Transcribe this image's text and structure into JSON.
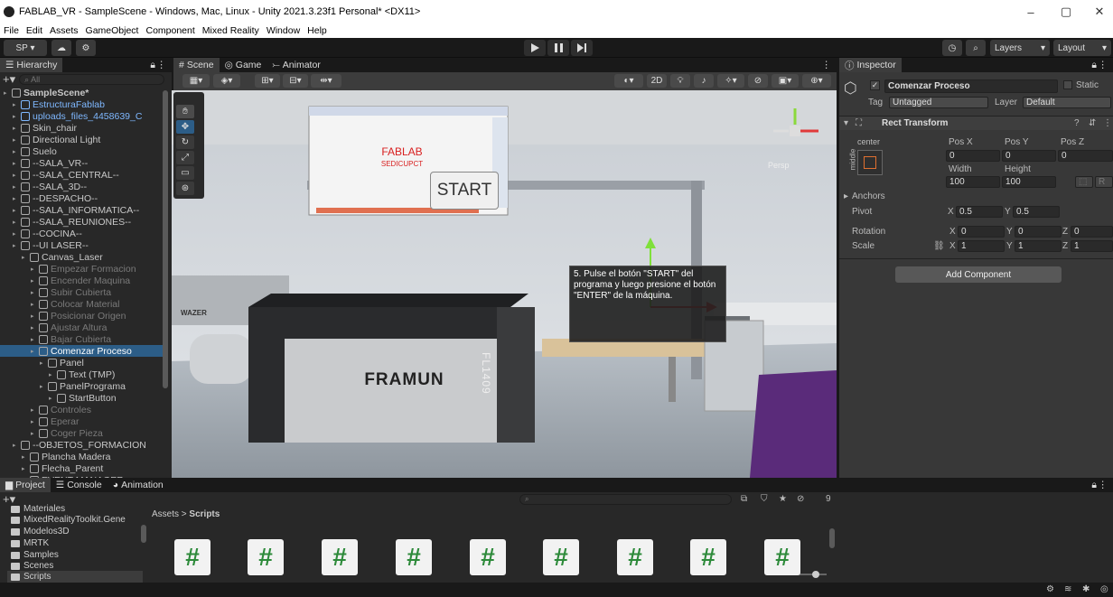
{
  "window": {
    "title": "FABLAB_VR - SampleScene - Windows, Mac, Linux - Unity 2021.3.23f1 Personal* <DX11>",
    "minimize": "–",
    "maximize": "▢",
    "close": "✕"
  },
  "menu": [
    "File",
    "Edit",
    "Assets",
    "GameObject",
    "Component",
    "Mixed Reality",
    "Window",
    "Help"
  ],
  "toolbar": {
    "account": "SP ▾",
    "layers": "Layers",
    "layout": "Layout"
  },
  "hierarchy": {
    "tab": "Hierarchy",
    "search": "All",
    "rows": [
      {
        "text": "SampleScene*",
        "indent": 0,
        "style": "scene"
      },
      {
        "text": "EstructuraFablab",
        "indent": 1,
        "style": "blue"
      },
      {
        "text": "uploads_files_4458639_C",
        "indent": 1,
        "style": "blue"
      },
      {
        "text": "Skin_chair",
        "indent": 1,
        "style": "normal"
      },
      {
        "text": "Directional Light",
        "indent": 1,
        "style": "normal"
      },
      {
        "text": "Suelo",
        "indent": 1,
        "style": "normal"
      },
      {
        "text": "--SALA_VR--",
        "indent": 1,
        "style": "normal"
      },
      {
        "text": "--SALA_CENTRAL--",
        "indent": 1,
        "style": "normal"
      },
      {
        "text": "--SALA_3D--",
        "indent": 1,
        "style": "normal"
      },
      {
        "text": "--DESPACHO--",
        "indent": 1,
        "style": "normal"
      },
      {
        "text": "--SALA_INFORMATICA--",
        "indent": 1,
        "style": "normal"
      },
      {
        "text": "--SALA_REUNIONES--",
        "indent": 1,
        "style": "normal"
      },
      {
        "text": "--COCINA--",
        "indent": 1,
        "style": "normal"
      },
      {
        "text": "--UI LASER--",
        "indent": 1,
        "style": "normal"
      },
      {
        "text": "Canvas_Laser",
        "indent": 2,
        "style": "normal"
      },
      {
        "text": "Empezar Formacion",
        "indent": 3,
        "style": "dim"
      },
      {
        "text": "Encender Maquina",
        "indent": 3,
        "style": "dim"
      },
      {
        "text": "Subir Cubierta",
        "indent": 3,
        "style": "dim"
      },
      {
        "text": "Colocar Material",
        "indent": 3,
        "style": "dim"
      },
      {
        "text": "Posicionar Origen",
        "indent": 3,
        "style": "dim"
      },
      {
        "text": "Ajustar Altura",
        "indent": 3,
        "style": "dim"
      },
      {
        "text": "Bajar Cubierta",
        "indent": 3,
        "style": "dim"
      },
      {
        "text": "Comenzar Proceso",
        "indent": 3,
        "style": "sel"
      },
      {
        "text": "Panel",
        "indent": 4,
        "style": "normal"
      },
      {
        "text": "Text (TMP)",
        "indent": 5,
        "style": "normal"
      },
      {
        "text": "PanelPrograma",
        "indent": 4,
        "style": "normal"
      },
      {
        "text": "StartButton",
        "indent": 5,
        "style": "normal"
      },
      {
        "text": "Controles",
        "indent": 3,
        "style": "dim"
      },
      {
        "text": "Eperar",
        "indent": 3,
        "style": "dim"
      },
      {
        "text": "Coger Pieza",
        "indent": 3,
        "style": "dim"
      },
      {
        "text": "--OBJETOS_FORMACION",
        "indent": 1,
        "style": "normal"
      },
      {
        "text": "Plancha Madera",
        "indent": 2,
        "style": "normal"
      },
      {
        "text": "Flecha_Parent",
        "indent": 2,
        "style": "normal"
      },
      {
        "text": "EVENT MANAGER",
        "indent": 2,
        "style": "normal"
      }
    ]
  },
  "scene": {
    "tabs": [
      "Scene",
      "Game",
      "Animator"
    ],
    "mode_2d": "2D",
    "persp": "Persp",
    "screen_logo_line1": "FABLAB",
    "screen_logo_line2": "SEDICUPCT",
    "start_button": "START",
    "machine_brand": "FRAMUN",
    "machine_model": "FL1409",
    "side_machine": "WAZER",
    "instruction": "5. Pulse el botón \"START\" del programa y luego presione el botón \"ENTER\" de la máquina."
  },
  "inspector": {
    "tab": "Inspector",
    "object_name": "Comenzar Proceso",
    "static": "Static",
    "tag_label": "Tag",
    "tag_value": "Untagged",
    "layer_label": "Layer",
    "layer_value": "Default",
    "component": "Rect Transform",
    "anchor_preset": "center",
    "anchor_side": "middle",
    "pos_labels": [
      "Pos X",
      "Pos Y",
      "Pos Z"
    ],
    "pos_values": [
      "0",
      "0",
      "0"
    ],
    "size_labels": [
      "Width",
      "Height"
    ],
    "size_values": [
      "100",
      "100"
    ],
    "anchors": "Anchors",
    "pivot_label": "Pivot",
    "pivot": {
      "x": "0.5",
      "y": "0.5"
    },
    "rotation_label": "Rotation",
    "rotation": {
      "x": "0",
      "y": "0",
      "z": "0"
    },
    "scale_label": "Scale",
    "scale": {
      "x": "1",
      "y": "1",
      "z": "1"
    },
    "add_component": "Add Component",
    "axis_x": "X",
    "axis_y": "Y",
    "axis_z": "Z",
    "r_button": "R"
  },
  "project": {
    "tabs": [
      "Project",
      "Console",
      "Animation"
    ],
    "folders": [
      "Materiales",
      "MixedRealityToolkit.Gene",
      "Modelos3D",
      "MRTK",
      "Samples",
      "Scenes",
      "Scripts"
    ],
    "breadcrumb_root": "Assets",
    "breadcrumb_sep": ">",
    "breadcrumb_current": "Scripts",
    "hidden_count": "9",
    "script_icon": "#"
  },
  "colors": {
    "selection": "#2c5d87",
    "accent_blue": "#7fb8ff",
    "panel": "#282828",
    "inspector": "#383838"
  }
}
